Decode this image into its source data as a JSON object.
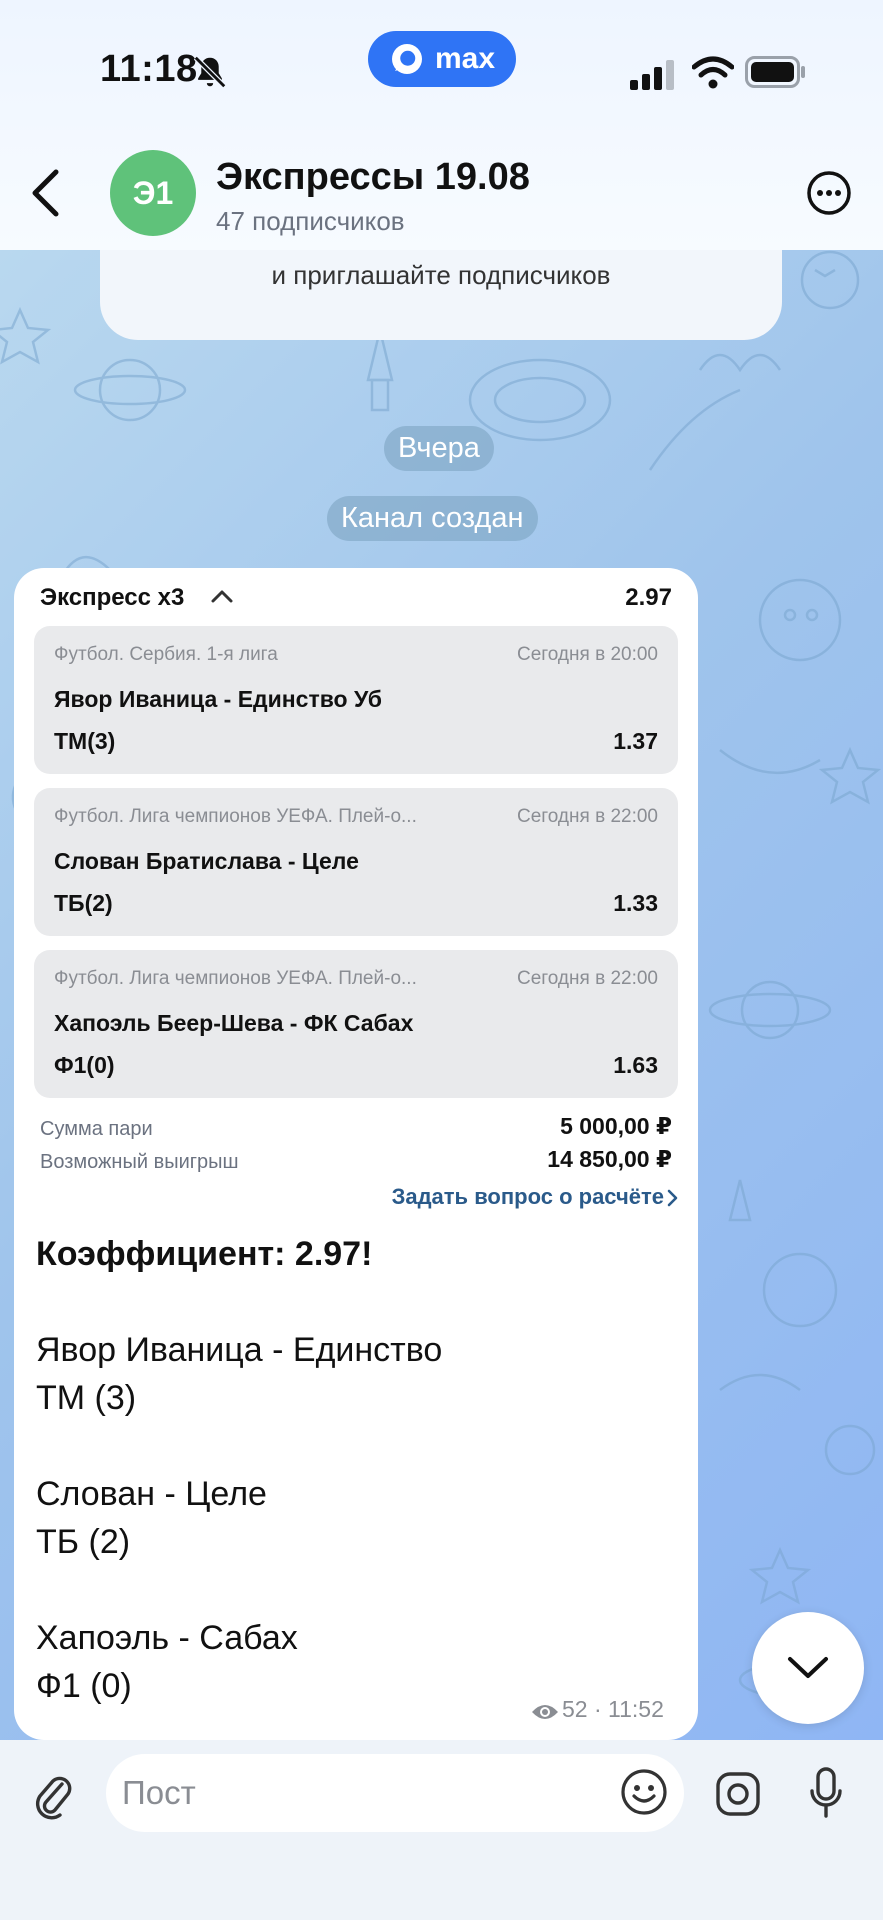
{
  "status": {
    "time": "11:18",
    "app_pill": "max"
  },
  "header": {
    "avatar_initials": "Э1",
    "avatar_color": "#5fc27a",
    "title": "Экспрессы 19.08",
    "subtitle": "47 подписчиков"
  },
  "chat": {
    "invite_text": "и приглашайте подписчиков",
    "date_chip": "Вчера",
    "service_chip": "Канал создан"
  },
  "bet": {
    "title": "Экспресс x3",
    "total_odds": "2.97",
    "events": [
      {
        "league": "Футбол. Сербия. 1-я лига",
        "time": "Сегодня в 20:00",
        "match": "Явор Иваница - Единство Уб",
        "market": "ТМ(3)",
        "odds": "1.37"
      },
      {
        "league": "Футбол. Лига чемпионов УЕФА. Плей-о...",
        "time": "Сегодня в 22:00",
        "match": "Слован Братислава - Целе",
        "market": "ТБ(2)",
        "odds": "1.33"
      },
      {
        "league": "Футбол. Лига чемпионов УЕФА. Плей-о...",
        "time": "Сегодня в 22:00",
        "match": "Хапоэль Беер-Шева - ФК Сабах",
        "market": "Ф1(0)",
        "odds": "1.63"
      }
    ],
    "stake_label": "Сумма пари",
    "stake_value": "5 000,00 ₽",
    "win_label": "Возможный выигрыш",
    "win_value": "14 850,00 ₽",
    "ask_link": "Задать вопрос о расчёте"
  },
  "message": {
    "coef_line": "Коэффициент: 2.97!",
    "lines": [
      "Явор Иваница - Единство",
      "ТМ (3)",
      "Слован - Целе",
      "ТБ (2)",
      "Хапоэль - Сабах",
      "Ф1 (0)"
    ],
    "views": "52",
    "time": "· 11:52"
  },
  "input": {
    "placeholder": "Пост"
  },
  "colors": {
    "accent": "#2f74f5",
    "link": "#2a5a8a"
  },
  "icons": [
    "silent-bell-icon",
    "signal-icon",
    "wifi-icon",
    "battery-icon",
    "back-arrow-icon",
    "more-icon",
    "chevron-up-icon",
    "chevron-right-icon",
    "eye-icon",
    "chevron-down-icon",
    "paperclip-icon",
    "emoji-icon",
    "camera-icon",
    "microphone-icon"
  ]
}
